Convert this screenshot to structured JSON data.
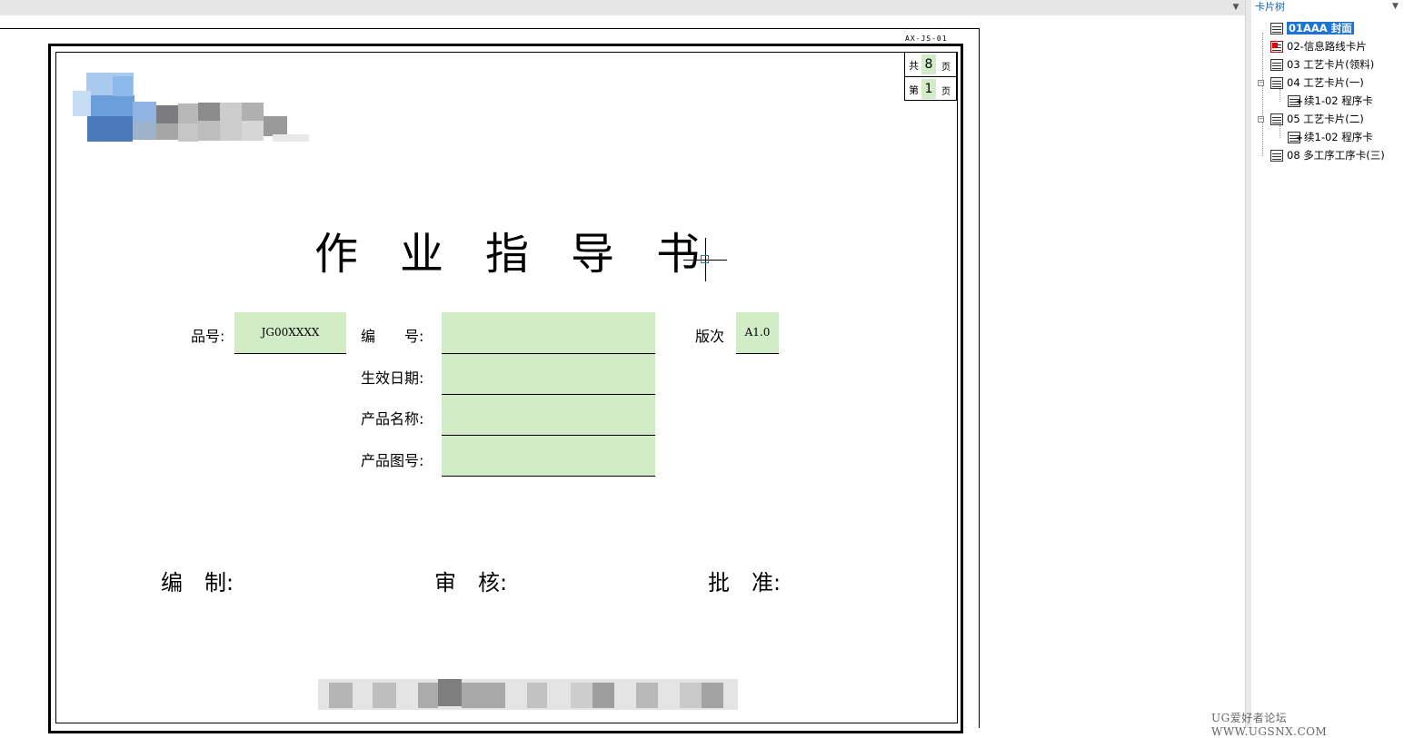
{
  "sheet": {
    "code": "AX-JS-01",
    "page_total_label": "共",
    "page_total": "8",
    "page_total_unit": "页",
    "page_current_label": "第",
    "page_current": "1",
    "page_current_unit": "页"
  },
  "document": {
    "title": "作业指导书",
    "part_no_label": "品号:",
    "part_no_value": "JG00XXXX",
    "number_label": "编　　号:",
    "number_value": "",
    "effective_date_label": "生效日期:",
    "effective_date_value": "",
    "product_name_label": "产品名称:",
    "product_name_value": "",
    "product_drawing_label": "产品图号:",
    "product_drawing_value": "",
    "revision_label": "版次",
    "revision_value": "A1.0",
    "field_color": "#d2ecc8"
  },
  "signatures": {
    "prepared": "编　制:",
    "reviewed": "审　核:",
    "approved": "批　准:"
  },
  "card_tree": {
    "title": "卡片树",
    "items": [
      {
        "label": "01AAA 封面",
        "icon": "card-grid-icon",
        "selected": true
      },
      {
        "label": "02-信息路线卡片",
        "icon": "route-card-icon",
        "selected": false
      },
      {
        "label": "03 工艺卡片(领料)",
        "icon": "card-grid-icon",
        "selected": false
      },
      {
        "label": "04 工艺卡片(一)",
        "icon": "card-grid-icon",
        "selected": false
      },
      {
        "label": "续1-02 程序卡",
        "icon": "sub-card-icon",
        "selected": false
      },
      {
        "label": "05 工艺卡片(二)",
        "icon": "card-grid-icon",
        "selected": false
      },
      {
        "label": "续1-02 程序卡",
        "icon": "sub-card-icon",
        "selected": false
      },
      {
        "label": "08 多工序工序卡(三)",
        "icon": "card-grid-icon",
        "selected": false
      }
    ]
  },
  "watermark": "UG爱好者论坛 WWW.UGSNX.COM",
  "colors": {
    "selection": "#1e74d0",
    "tree_title": "#1a5fb4"
  }
}
